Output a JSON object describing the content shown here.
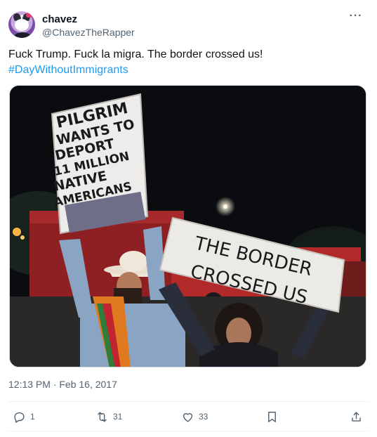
{
  "author": {
    "name": "chavez",
    "handle": "@ChavezTheRapper",
    "avatar_icon": "hello-kitty-kuromi-avatar"
  },
  "tweet": {
    "text": "Fuck Trump. Fuck la migra. The border crossed us!",
    "hashtag": "#DayWithoutImmigrants",
    "timestamp": "12:13 PM · Feb 16, 2017"
  },
  "media": {
    "sign_left": [
      "PILGRIM",
      "WANTS TO",
      "DEPORT",
      "11 MILLION",
      "NATIVE",
      "AMERICANS"
    ],
    "sign_right": [
      "THE BORDER",
      "CROSSED US"
    ]
  },
  "actions": {
    "replies": "1",
    "retweets": "31",
    "likes": "33"
  },
  "colors": {
    "link": "#1d9bf0",
    "muted": "#536471",
    "text": "#0f1419"
  }
}
